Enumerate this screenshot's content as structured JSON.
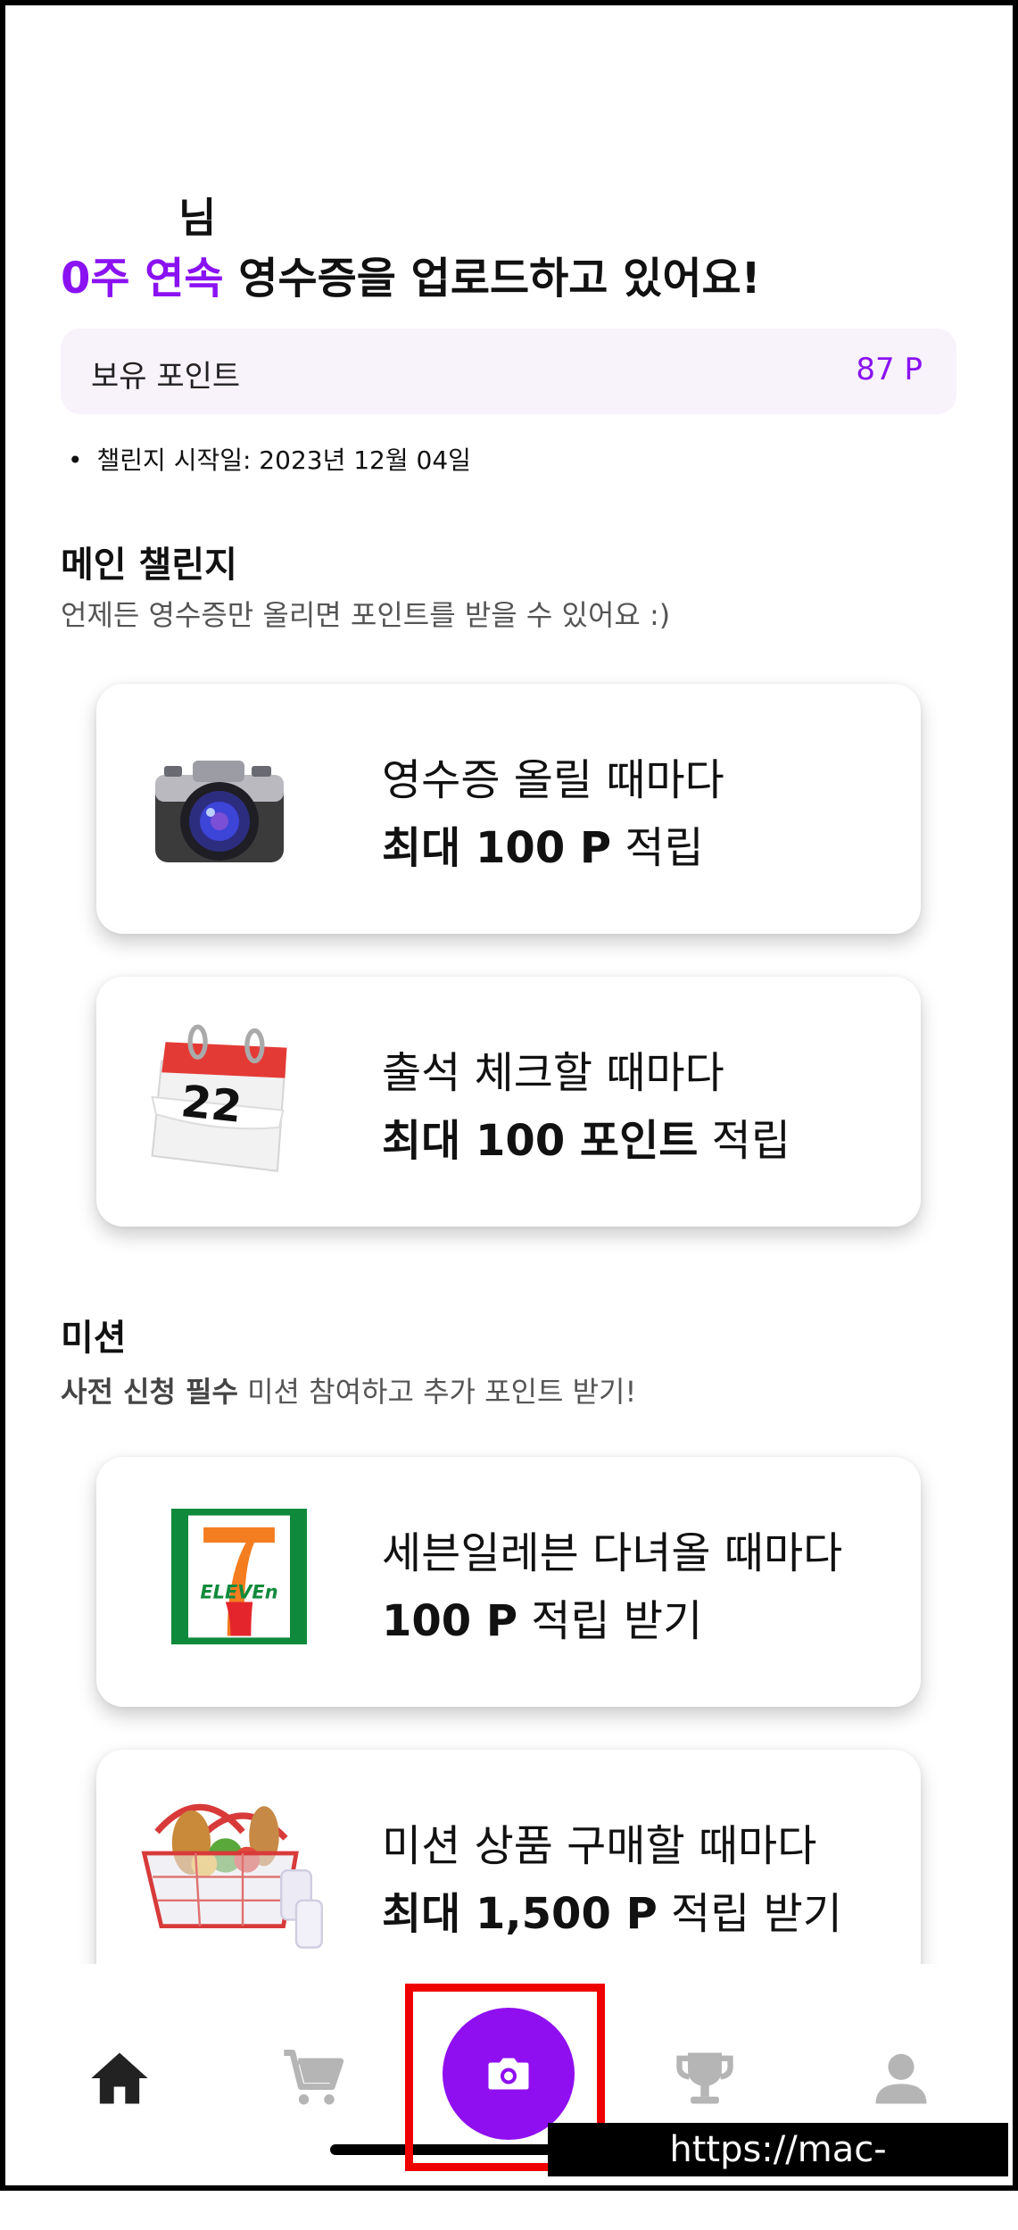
{
  "header": {
    "user_name": "님",
    "streak_highlight": "0주 연속",
    "streak_text": " 영수증을 업로드하고 있어요!"
  },
  "points": {
    "label": "보유 포인트",
    "value": "87 P"
  },
  "challenge_start": {
    "bullet": "•",
    "text": "챌린지 시작일: 2023년 12월 04일"
  },
  "main_challenge": {
    "title": "메인 챌린지",
    "subtitle": "언제든 영수증만 올리면 포인트를 받을 수 있어요 :)",
    "cards": [
      {
        "icon": "camera-icon",
        "line1": "영수증 올릴 때마다",
        "line2_bold": "최대 100 P",
        "line2_rest": " 적립"
      },
      {
        "icon": "calendar-icon",
        "calendar_day": "22",
        "line1": "출석 체크할 때마다",
        "line2_bold": "최대 100 포인트",
        "line2_rest": " 적립"
      }
    ]
  },
  "missions": {
    "title": "미션",
    "subtitle_bold": "사전 신청 필수",
    "subtitle_rest": " 미션 참여하고 추가 포인트 받기!",
    "cards": [
      {
        "icon": "seven-eleven-logo",
        "logo_text": "ELEVEn",
        "line1": "세븐일레븐 다녀올 때마다",
        "line2_bold": "100 P",
        "line2_rest": " 적립 받기"
      },
      {
        "icon": "shopping-basket-icon",
        "line1": "미션 상품 구매할 때마다",
        "line2_bold": "최대 1,500 P",
        "line2_rest": " 적립 받기"
      }
    ]
  },
  "tabbar": {
    "items": [
      {
        "icon": "home-icon"
      },
      {
        "icon": "cart-icon"
      },
      {
        "icon": "camera-icon",
        "active": true
      },
      {
        "icon": "trophy-icon"
      },
      {
        "icon": "profile-icon"
      }
    ]
  },
  "watermark": "https://mac-os.tistory.com",
  "colors": {
    "accent": "#8a12f2",
    "fab": "#8f0ff0",
    "points_bg": "#f8f2fb",
    "highlight": "#ee0000"
  }
}
